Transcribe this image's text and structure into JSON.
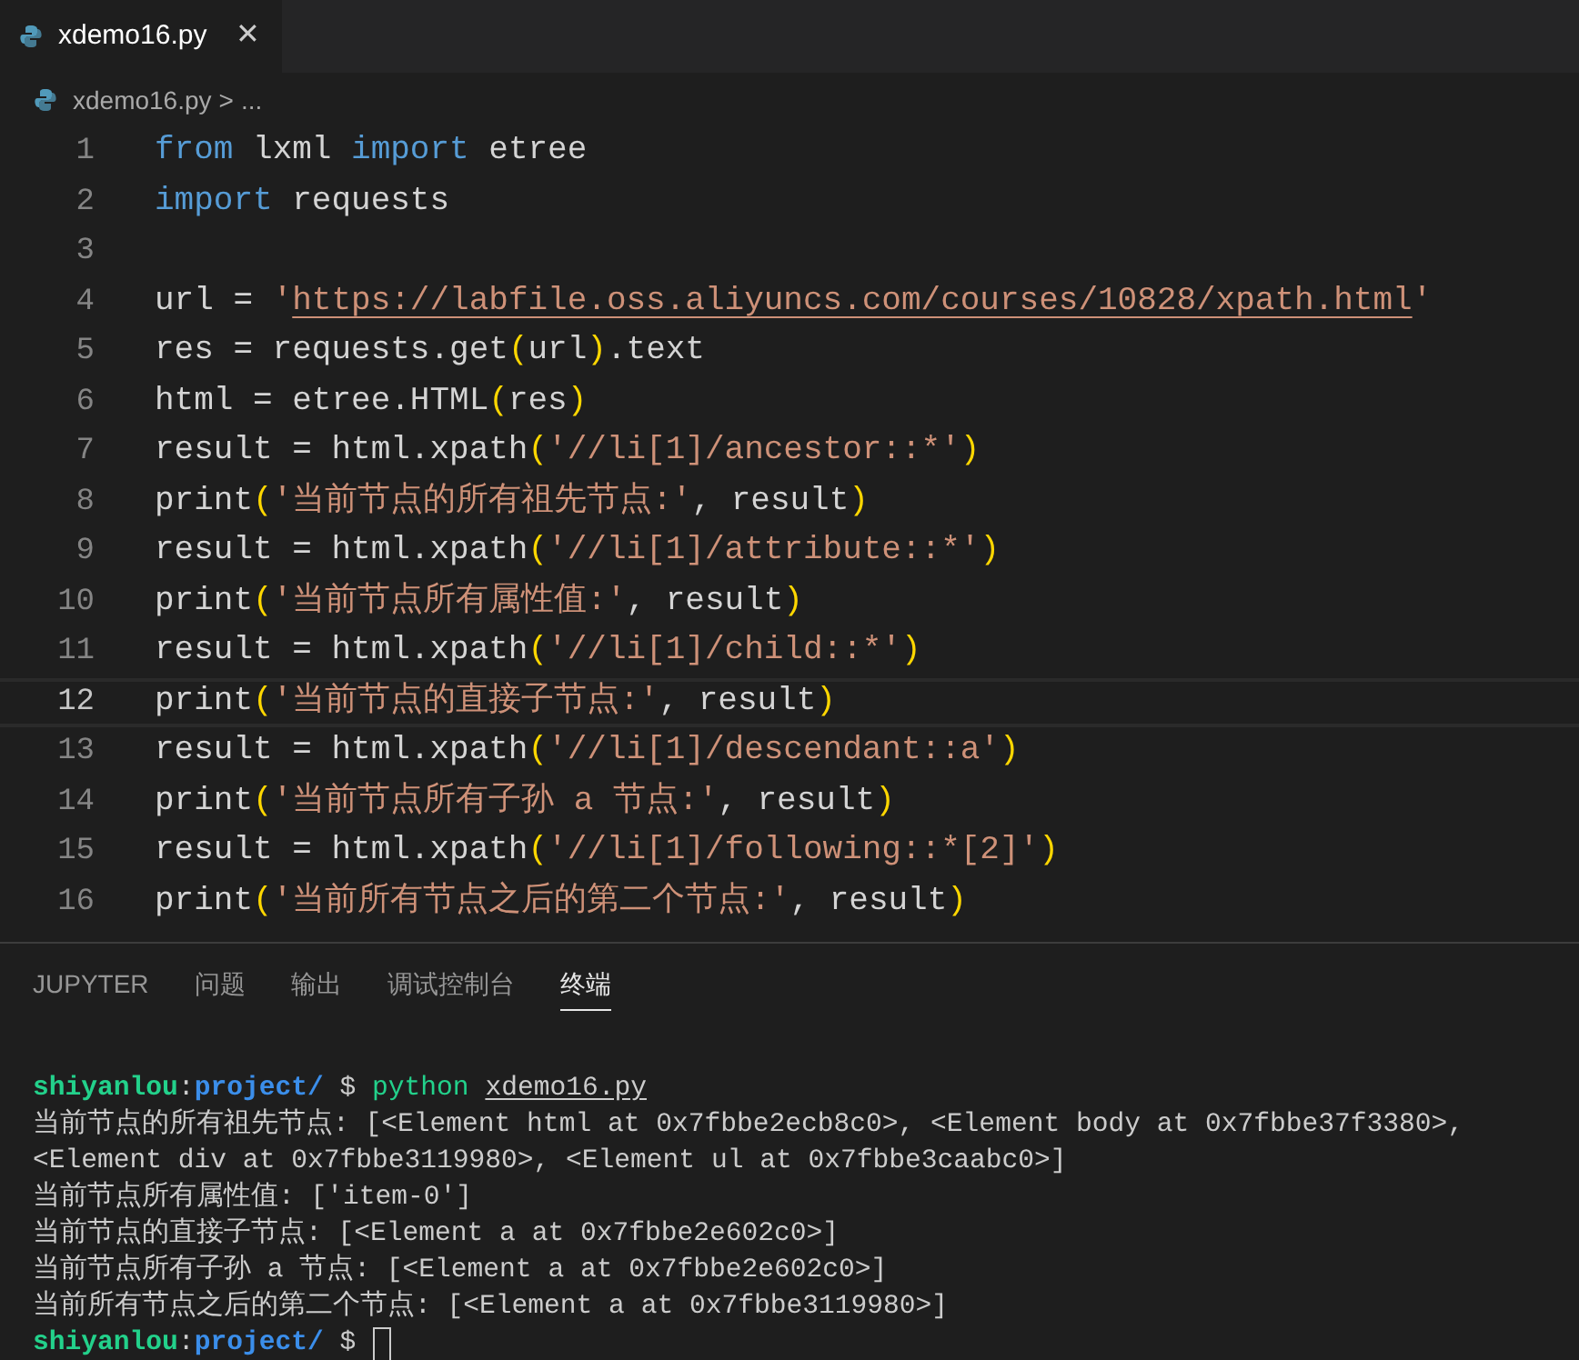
{
  "tab": {
    "title": "xdemo16.py",
    "close": "✕",
    "selected": true
  },
  "breadcrumb": {
    "file": "xdemo16.py",
    "separator": ">",
    "more": "..."
  },
  "code": {
    "lines": [
      {
        "number": "1",
        "current": false,
        "tokens": [
          {
            "kind": "kw",
            "text": "from"
          },
          {
            "kind": "text",
            "text": " lxml "
          },
          {
            "kind": "kw",
            "text": "import"
          },
          {
            "kind": "text",
            "text": " etree"
          }
        ]
      },
      {
        "number": "2",
        "current": false,
        "tokens": [
          {
            "kind": "kw",
            "text": "import"
          },
          {
            "kind": "text",
            "text": " requests"
          }
        ]
      },
      {
        "number": "3",
        "current": false
      },
      {
        "number": "4",
        "current": false,
        "tokens": [
          {
            "kind": "text",
            "text": "url = "
          },
          {
            "kind": "str",
            "text": "'"
          },
          {
            "kind": "link",
            "text": "https://labfile.oss.aliyuncs.com/courses/10828/xpath.html"
          },
          {
            "kind": "str",
            "text": "'"
          }
        ]
      },
      {
        "number": "5",
        "current": false,
        "tokens": [
          {
            "kind": "text",
            "text": "res = requests.get"
          },
          {
            "kind": "paren",
            "text": "("
          },
          {
            "kind": "text",
            "text": "url"
          },
          {
            "kind": "paren",
            "text": ")"
          },
          {
            "kind": "text",
            "text": ".text"
          }
        ]
      },
      {
        "number": "6",
        "current": false,
        "tokens": [
          {
            "kind": "text",
            "text": "html = etree.HTML"
          },
          {
            "kind": "paren",
            "text": "("
          },
          {
            "kind": "text",
            "text": "res"
          },
          {
            "kind": "paren",
            "text": ")"
          }
        ]
      },
      {
        "number": "7",
        "current": false,
        "tokens": [
          {
            "kind": "text",
            "text": "result = html.xpath"
          },
          {
            "kind": "paren",
            "text": "("
          },
          {
            "kind": "str",
            "text": "'//li[1]/ancestor::*'"
          },
          {
            "kind": "paren",
            "text": ")"
          }
        ]
      },
      {
        "number": "8",
        "current": false,
        "tokens": [
          {
            "kind": "text",
            "text": "print"
          },
          {
            "kind": "paren",
            "text": "("
          },
          {
            "kind": "str",
            "text": "'当前节点的所有祖先节点:'"
          },
          {
            "kind": "text",
            "text": ", result"
          },
          {
            "kind": "paren",
            "text": ")"
          }
        ]
      },
      {
        "number": "9",
        "current": false,
        "tokens": [
          {
            "kind": "text",
            "text": "result = html.xpath"
          },
          {
            "kind": "paren",
            "text": "("
          },
          {
            "kind": "str",
            "text": "'//li[1]/attribute::*'"
          },
          {
            "kind": "paren",
            "text": ")"
          }
        ]
      },
      {
        "number": "10",
        "current": false,
        "tokens": [
          {
            "kind": "text",
            "text": "print"
          },
          {
            "kind": "paren",
            "text": "("
          },
          {
            "kind": "str",
            "text": "'当前节点所有属性值:'"
          },
          {
            "kind": "text",
            "text": ", result"
          },
          {
            "kind": "paren",
            "text": ")"
          }
        ]
      },
      {
        "number": "11",
        "current": false,
        "tokens": [
          {
            "kind": "text",
            "text": "result = html.xpath"
          },
          {
            "kind": "paren",
            "text": "("
          },
          {
            "kind": "str",
            "text": "'//li[1]/child::*'"
          },
          {
            "kind": "paren",
            "text": ")"
          }
        ]
      },
      {
        "number": "12",
        "current": true,
        "tokens": [
          {
            "kind": "text",
            "text": "print"
          },
          {
            "kind": "paren",
            "text": "("
          },
          {
            "kind": "str",
            "text": "'当前节点的直接子节点:'"
          },
          {
            "kind": "text",
            "text": ", result"
          },
          {
            "kind": "paren",
            "text": ")"
          }
        ]
      },
      {
        "number": "13",
        "current": false,
        "tokens": [
          {
            "kind": "text",
            "text": "result = html.xpath"
          },
          {
            "kind": "paren",
            "text": "("
          },
          {
            "kind": "str",
            "text": "'//li[1]/descendant::a'"
          },
          {
            "kind": "paren",
            "text": ")"
          }
        ]
      },
      {
        "number": "14",
        "current": false,
        "tokens": [
          {
            "kind": "text",
            "text": "print"
          },
          {
            "kind": "paren",
            "text": "("
          },
          {
            "kind": "str",
            "text": "'当前节点所有子孙 a 节点:'"
          },
          {
            "kind": "text",
            "text": ", result"
          },
          {
            "kind": "paren",
            "text": ")"
          }
        ]
      },
      {
        "number": "15",
        "current": false,
        "tokens": [
          {
            "kind": "text",
            "text": "result = html.xpath"
          },
          {
            "kind": "paren",
            "text": "("
          },
          {
            "kind": "str",
            "text": "'//li[1]/following::*[2]'"
          },
          {
            "kind": "paren",
            "text": ")"
          }
        ]
      },
      {
        "number": "16",
        "current": false,
        "tokens": [
          {
            "kind": "text",
            "text": "print"
          },
          {
            "kind": "paren",
            "text": "("
          },
          {
            "kind": "str",
            "text": "'当前所有节点之后的第二个节点:'"
          },
          {
            "kind": "text",
            "text": ", result"
          },
          {
            "kind": "paren",
            "text": ")"
          }
        ]
      }
    ]
  },
  "panel_tabs": [
    {
      "label": "JUPYTER",
      "selected": false
    },
    {
      "label": "问题",
      "selected": false
    },
    {
      "label": "输出",
      "selected": false
    },
    {
      "label": "调试控制台",
      "selected": false
    },
    {
      "label": "终端",
      "selected": true
    }
  ],
  "terminal": {
    "lines": [
      {
        "kind": "prompt",
        "user": "shiyanlou",
        "colon": ":",
        "path": "project/",
        "dollar": "$",
        "command": "python",
        "argument": "xdemo16.py"
      },
      {
        "kind": "output",
        "text": "当前节点的所有祖先节点: [<Element html at 0x7fbbe2ecb8c0>, <Element body at 0x7fbbe37f3380>,"
      },
      {
        "kind": "output",
        "text": "<Element div at 0x7fbbe3119980>, <Element ul at 0x7fbbe3caabc0>]"
      },
      {
        "kind": "output",
        "text": "当前节点所有属性值: ['item-0']"
      },
      {
        "kind": "output",
        "text": "当前节点的直接子节点: [<Element a at 0x7fbbe2e602c0>]"
      },
      {
        "kind": "output",
        "text": "当前节点所有子孙 a 节点: [<Element a at 0x7fbbe2e602c0>]"
      },
      {
        "kind": "output",
        "text": "当前所有节点之后的第二个节点: [<Element a at 0x7fbbe3119980>]"
      },
      {
        "kind": "cursor",
        "user": "shiyanlou",
        "colon": ":",
        "path": "project/",
        "dollar": "$"
      }
    ]
  }
}
